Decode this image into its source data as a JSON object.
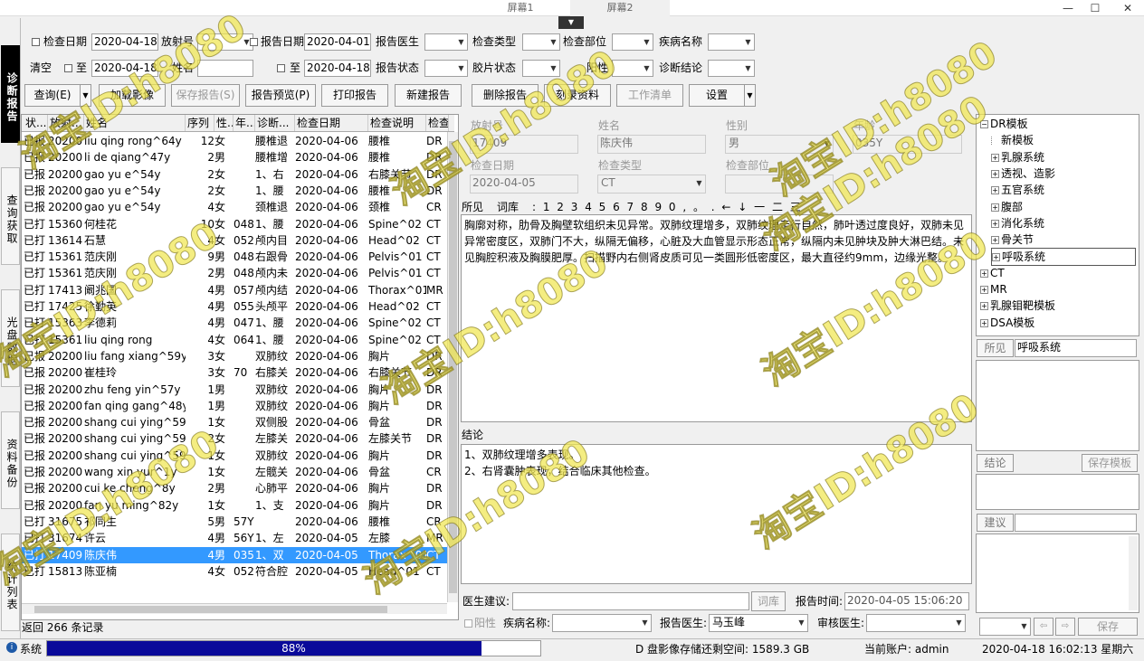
{
  "topbar": {
    "tab1": "屏幕1",
    "tab2": "屏幕2",
    "min": "—",
    "max": "☐",
    "close": "✕"
  },
  "sidebar": [
    "诊断报告",
    "查询获取",
    "光盘数据",
    "资料备份",
    "统计列表"
  ],
  "filters": {
    "exam_date_label": "检查日期",
    "exam_date_from": "2020-04-18",
    "radio_no_label": "放射号",
    "report_date_label": "报告日期",
    "report_date_from": "2020-04-01",
    "report_doctor_label": "报告医生",
    "exam_type_label": "检查类型",
    "exam_part_label": "检查部位",
    "disease_label": "疾病名称",
    "clear_label": "清空",
    "to1": "至",
    "exam_date_to": "2020-04-18",
    "name_label": "姓名",
    "to2": "至",
    "report_date_to": "2020-04-18",
    "report_status_label": "报告状态",
    "film_status_label": "胶片状态",
    "positive_label": "阳性",
    "diagnosis_label": "诊断结论"
  },
  "toolbar": {
    "query": "查询(E)",
    "load_image": "加载影像",
    "save_report": "保存报告(S)",
    "preview": "报告预览(P)",
    "print": "打印报告",
    "new_report": "新建报告",
    "delete_report": "删除报告",
    "burn": "刻录资料",
    "worklist": "工作清单",
    "settings": "设置"
  },
  "grid": {
    "headers": [
      "状...",
      "放射...",
      "姓名",
      "序列",
      "性...",
      "年...",
      "诊断...",
      "检查日期",
      "检查说明",
      "检查"
    ],
    "rows": [
      [
        "已报",
        "20200",
        "liu qing rong^64y",
        "12",
        "女",
        "",
        "腰椎退",
        "2020-04-06",
        "腰椎",
        "DR"
      ],
      [
        "已报",
        "20200",
        "li de qiang^47y",
        "2",
        "男",
        "",
        "腰椎增",
        "2020-04-06",
        "腰椎",
        "DR"
      ],
      [
        "已报",
        "20200",
        "gao yu e^54y",
        "2",
        "女",
        "",
        "1、右",
        "2020-04-06",
        "右膝关节",
        "DR"
      ],
      [
        "已报",
        "20200",
        "gao yu e^54y",
        "2",
        "女",
        "",
        "1、腰",
        "2020-04-06",
        "腰椎",
        "DR"
      ],
      [
        "已报",
        "20200",
        "gao yu e^54y",
        "4",
        "女",
        "",
        "颈椎退",
        "2020-04-06",
        "颈椎",
        "CR"
      ],
      [
        "已打",
        "15360",
        "何桂花",
        "10",
        "女",
        "048",
        "1、腰",
        "2020-04-06",
        "Spine^02",
        "CT"
      ],
      [
        "已打",
        "13614",
        "石慧",
        "4",
        "女",
        "052",
        "颅内目",
        "2020-04-06",
        "Head^02",
        "CT"
      ],
      [
        "已打",
        "15361",
        "范庆刚",
        "9",
        "男",
        "048",
        "右跟骨",
        "2020-04-06",
        "Pelvis^01",
        "CT"
      ],
      [
        "已打",
        "15361",
        "范庆刚",
        "2",
        "男",
        "048",
        "颅内未",
        "2020-04-06",
        "Pelvis^01",
        "CT"
      ],
      [
        "已打",
        "17413",
        "阚兆国",
        "4",
        "男",
        "057",
        "颅内结",
        "2020-04-06",
        "Thorax^01",
        "MR"
      ],
      [
        "已打",
        "17425",
        "徐勤英",
        "4",
        "男",
        "055",
        "头颅平",
        "2020-04-06",
        "Head^02",
        "CT"
      ],
      [
        "已打",
        "15363",
        "李德莉",
        "4",
        "男",
        "047",
        "1、腰",
        "2020-04-06",
        "Spine^02",
        "CT"
      ],
      [
        "已打",
        "15361",
        "liu qing rong",
        "4",
        "女",
        "064",
        "1、腰",
        "2020-04-06",
        "Spine^02",
        "CT"
      ],
      [
        "已报",
        "20200",
        "liu fang xiang^59y",
        "3",
        "女",
        "",
        "双肺纹",
        "2020-04-06",
        "胸片",
        "DR"
      ],
      [
        "已报",
        "20200",
        "崔桂玲",
        "3",
        "女",
        "70",
        "右膝关",
        "2020-04-06",
        "右膝关节",
        "DR"
      ],
      [
        "已报",
        "20200",
        "zhu feng yin^57y",
        "1",
        "男",
        "",
        "双肺纹",
        "2020-04-06",
        "胸片",
        "DR"
      ],
      [
        "已报",
        "20200",
        "fan qing gang^48y",
        "1",
        "男",
        "",
        "双肺纹",
        "2020-04-06",
        "胸片",
        "DR"
      ],
      [
        "已报",
        "20200",
        "shang cui ying^59",
        "1",
        "女",
        "",
        "双侧股",
        "2020-04-06",
        "骨盆",
        "DR"
      ],
      [
        "已报",
        "20200",
        "shang cui ying^59",
        "2",
        "女",
        "",
        "左膝关",
        "2020-04-06",
        "左膝关节",
        "DR"
      ],
      [
        "已报",
        "20200",
        "shang cui ying^59",
        "1",
        "女",
        "",
        "双肺纹",
        "2020-04-06",
        "胸片",
        "DR"
      ],
      [
        "已报",
        "20200",
        "wang xin yur^1y",
        "1",
        "女",
        "",
        "左髋关",
        "2020-04-06",
        "骨盆",
        "CR"
      ],
      [
        "已报",
        "20200",
        "cui ke cheng^8y",
        "2",
        "男",
        "",
        "心肺平",
        "2020-04-06",
        "胸片",
        "DR"
      ],
      [
        "已报",
        "20200",
        "fan yu ming^82y",
        "1",
        "女",
        "",
        "1、支",
        "2020-04-06",
        "胸片",
        "DR"
      ],
      [
        "已打",
        "31675",
        "祁同生",
        "5",
        "男",
        "57Y",
        "",
        "2020-04-06",
        "腰椎",
        "CR"
      ],
      [
        "已打",
        "31674",
        "许云",
        "4",
        "男",
        "56Y",
        "1、左",
        "2020-04-05",
        "左膝",
        "MR"
      ],
      [
        "已打",
        "17409",
        "陈庆伟",
        "4",
        "男",
        "035",
        "1、双",
        "2020-04-05",
        "Thorax^01",
        "CT"
      ],
      [
        "已打",
        "15813",
        "陈亚楠",
        "4",
        "女",
        "052",
        "符合腔",
        "2020-04-05",
        "Head^01",
        "CT"
      ]
    ],
    "selected_row": 25,
    "record_count": "返回 266 条记录"
  },
  "patient": {
    "radio_label": "放射号",
    "radio_value": "17409",
    "name_label": "姓名",
    "name_value": "陈庆伟",
    "sex_label": "性别",
    "sex_value": "男",
    "age_label": "年龄",
    "age_value": "035Y",
    "exam_date_label": "检查日期",
    "exam_date_value": "2020-04-05",
    "exam_type_label": "检查类型",
    "exam_type_value": "CT",
    "exam_part_label": "检查部位"
  },
  "findings": {
    "label": "所见",
    "dict_label": "词库",
    "dict_chars": ": 1 2 3 4 5 6 7 8 9 0 , 。 . ← ↓ 一 二 三",
    "text": "胸廓对称，肋骨及胸壁软组织未见异常。双肺纹理增多，双肺纹理走行自然，肺叶透过度良好，双肺未见异常密度区，双肺门不大，纵隔无偏移，心脏及大血管显示形态正常，纵隔内未见肿块及肿大淋巴结。未见胸腔积液及胸膜肥厚。扫描野内右侧肾皮质可见一类圆形低密度区，最大直径约9mm，边缘光整。"
  },
  "conclusion": {
    "label": "结论",
    "text": "1、双肺纹理增多表现。\n2、右肾囊肿表现，结合临床其他检查。"
  },
  "bottom": {
    "advice_label": "医生建议:",
    "dict_btn": "词库",
    "report_time_label": "报告时间:",
    "report_time_value": "2020-04-05 15:06:20",
    "positive_label": "阳性",
    "disease_label": "疾病名称:",
    "report_doctor_label": "报告医生:",
    "report_doctor_value": "马玉峰",
    "review_doctor_label": "审核医生:"
  },
  "tree": [
    {
      "t": "DR模板",
      "lvl": 0,
      "exp": "⊟"
    },
    {
      "t": "新模板",
      "lvl": 1,
      "exp": ""
    },
    {
      "t": "乳腺系统",
      "lvl": 1,
      "exp": "+"
    },
    {
      "t": "透视、造影",
      "lvl": 1,
      "exp": "+"
    },
    {
      "t": "五官系统",
      "lvl": 1,
      "exp": "+"
    },
    {
      "t": "腹部",
      "lvl": 1,
      "exp": "+"
    },
    {
      "t": "消化系统",
      "lvl": 1,
      "exp": "+"
    },
    {
      "t": "骨关节",
      "lvl": 1,
      "exp": "+"
    },
    {
      "t": "呼吸系统",
      "lvl": 1,
      "exp": "+"
    },
    {
      "t": "CT",
      "lvl": 0,
      "exp": "+"
    },
    {
      "t": "MR",
      "lvl": 0,
      "exp": "+"
    },
    {
      "t": "乳腺钼靶模板",
      "lvl": 0,
      "exp": "+"
    },
    {
      "t": "DSA模板",
      "lvl": 0,
      "exp": "+"
    }
  ],
  "right": {
    "findings_btn": "所见",
    "findings_value": "呼吸系统",
    "conclusion_btn": "结论",
    "save_template": "保存模板",
    "advice_btn": "建议",
    "save_btn": "保存"
  },
  "status": {
    "system": "系统",
    "progress": "88%",
    "progress_fraction": 0.88,
    "disk": "D 盘影像存储还剩空间: 1589.3 GB",
    "account": "当前账户: admin",
    "datetime": "2020-04-18 16:02:13 星期六"
  },
  "watermark": "淘宝ID:h8080"
}
